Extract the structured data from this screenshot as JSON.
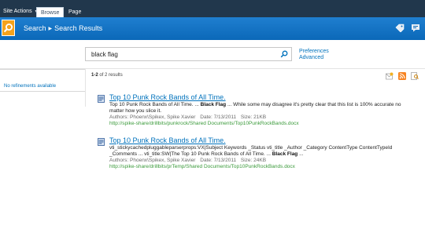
{
  "ribbon": {
    "site_actions": "Site Actions",
    "tabs": [
      "Browse",
      "Page"
    ]
  },
  "header": {
    "breadcrumb": [
      "Search",
      "Search Results"
    ]
  },
  "search": {
    "query": "black flag",
    "preferences_link": "Preferences",
    "advanced_link": "Advanced"
  },
  "refinements": {
    "empty_text": "No refinements available"
  },
  "results_summary": {
    "range": "1-2",
    "suffix": "of 2 results"
  },
  "results": [
    {
      "title": "Top 10 Punk Rock Bands of All Time.",
      "snippet_pre": "Top 10 Punk Rock Bands of All Time. ... ",
      "snippet_bold": "Black Flag",
      "snippet_post": " ... While some may disagree it's pretty clear that this list is 100% accurate no matter how you slice it.",
      "authors": "Authors: Phoenx\\Spikex, Spike Xavier",
      "date": "Date: 7/13/2011",
      "size": "Size: 21KB",
      "url": "http://spike-share/drillbits/punkrock/Shared Documents/Top10PunkRockBands.docx"
    },
    {
      "title": "Top 10 Punk Rock Bands of All Time.",
      "snippet_pre": "vti_stickycachedpluggableparserprops:VX|Subject Keywords _Status vti_title _Author _Category ContentType ContentTypeId _Comments ... vti_title:SW|The Top 10 Punk Rock Bands of All Time. ... ",
      "snippet_bold": "Black Flag",
      "snippet_post": " ...",
      "authors": "Authors: Phoenx\\Spikex, Spike Xavier",
      "date": "Date: 7/13/2011",
      "size": "Size: 24KB",
      "url": "http://spike-share/drillbits/prTemp/Shared Documents/Top10PunkRockBands.docx"
    }
  ],
  "colors": {
    "ribbon_bg": "#21374c",
    "title_bar": "#0b68b8",
    "link": "#0072bc",
    "url_green": "#3a9a3a",
    "logo_orange": "#f5a21b"
  },
  "icons": {
    "logo": "search-magnifier-icon",
    "title_right": [
      "tag-icon",
      "notes-icon"
    ],
    "result_doc": "word-document-icon",
    "result_tools": [
      "alert-icon",
      "rss-icon",
      "search-action-icon"
    ]
  }
}
